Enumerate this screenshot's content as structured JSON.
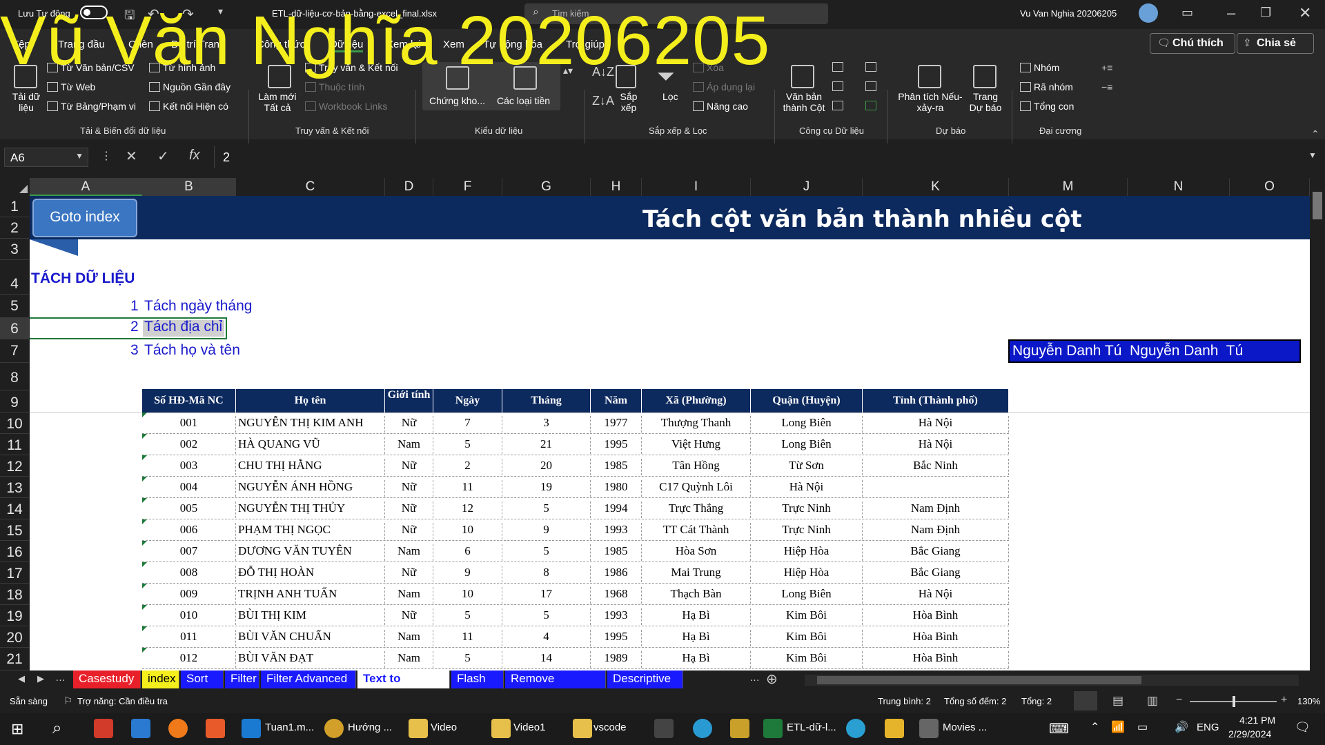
{
  "title_bar": {
    "autosave": "Lưu Tự động",
    "file": "ETL-dữ-liệu-cơ-bản-bằng-excel_final.xlsx",
    "search": "Tìm kiếm",
    "user": "Vu Van Nghia 20206205"
  },
  "watermark": "Vũ Văn Nghĩa 20206205",
  "menu_tabs": [
    "Tệp",
    "Trang đầu",
    "Chèn",
    "Bố trí Trang",
    "Công thức",
    "Dữ liệu",
    "Xem lại",
    "Xem",
    "Tự động hóa",
    "Trợ giúp"
  ],
  "comment_btn": "Chú thích",
  "share_btn": "Chia sẻ",
  "ribbon": {
    "get_data": "Tải dữ liệu",
    "from_text": "Từ Văn bản/CSV",
    "from_web": "Từ Web",
    "from_table": "Từ Bảng/Phạm vi",
    "from_picture": "Từ hình ảnh",
    "recent": "Nguồn Gần đây",
    "existing": "Kết nối Hiện có",
    "group1": "Tải & Biến đổi dữ liệu",
    "refresh": "Làm mới Tất cả",
    "queries": "Truy vấn & Kết nối",
    "properties": "Thuộc tính",
    "links": "Workbook Links",
    "group2": "Truy vấn & Kết nối",
    "stocks": "Chứng kho...",
    "currencies": "Các loại tiền",
    "group3": "Kiểu dữ liệu",
    "sort": "Sắp xếp",
    "filter": "Lọc",
    "clear": "Xóa",
    "reapply": "Áp dụng lại",
    "advanced": "Nâng cao",
    "group4": "Sắp xếp & Lọc",
    "text_to_col": "Văn bản thành Cột",
    "group5": "Công cụ Dữ liệu",
    "whatif": "Phân tích Nếu-xảy-ra",
    "forecast": "Trang Dự báo",
    "group6": "Dự báo",
    "group_btn": "Nhóm",
    "ungroup": "Rã nhóm",
    "subtotal": "Tổng con",
    "group7": "Đại cương"
  },
  "formula_bar": {
    "name_box": "A6",
    "value": "2"
  },
  "columns": [
    "A",
    "B",
    "C",
    "D",
    "F",
    "G",
    "H",
    "I",
    "J",
    "K",
    "M",
    "N",
    "O"
  ],
  "rows": [
    "1",
    "2",
    "3",
    "4",
    "5",
    "6",
    "7",
    "8",
    "9",
    "10",
    "11",
    "12",
    "13",
    "14",
    "15",
    "16",
    "17",
    "18",
    "19",
    "20",
    "21"
  ],
  "sheet": {
    "goto": "Goto index",
    "banner": "Tách cột văn bản thành nhiều cột",
    "heading": "TÁCH DỮ LIỆU",
    "items": [
      {
        "n": "1",
        "t": "Tách ngày tháng"
      },
      {
        "n": "2",
        "t": "Tách địa chỉ"
      },
      {
        "n": "3",
        "t": "Tách họ và tên"
      }
    ],
    "name_box_text": "Nguyễn Danh Tú  Nguyễn Danh  Tú",
    "headers": [
      "Số HĐ-Mã NC",
      "Họ tên",
      "Giới tính",
      "Ngày",
      "Tháng",
      "Năm",
      "Xã (Phường)",
      "Quận (Huyện)",
      "Tỉnh (Thành phố)"
    ],
    "data": [
      [
        "001",
        "NGUYỄN THỊ KIM ANH",
        "Nữ",
        "7",
        "3",
        "1977",
        "Thượng Thanh",
        "Long Biên",
        "Hà Nội"
      ],
      [
        "002",
        "HÀ QUANG VŨ",
        "Nam",
        "5",
        "21",
        "1995",
        "Việt Hưng",
        "Long Biên",
        "Hà Nội"
      ],
      [
        "003",
        "CHU THỊ HẰNG",
        "Nữ",
        "2",
        "20",
        "1985",
        "Tân Hồng",
        "Từ Sơn",
        "Bắc Ninh"
      ],
      [
        "004",
        "NGUYỄN ÁNH HỒNG",
        "Nữ",
        "11",
        "19",
        "1980",
        "C17 Quỳnh Lôi",
        "Hà Nội",
        ""
      ],
      [
        "005",
        "NGUYỄN THỊ THỦY",
        "Nữ",
        "12",
        "5",
        "1994",
        "Trực Thắng",
        "Trực Ninh",
        "Nam Định"
      ],
      [
        "006",
        "PHẠM THỊ NGỌC",
        "Nữ",
        "10",
        "9",
        "1993",
        "TT Cát Thành",
        "Trực Ninh",
        "Nam Định"
      ],
      [
        "007",
        "DƯƠNG VĂN TUYÊN",
        "Nam",
        "6",
        "5",
        "1985",
        "Hòa Sơn",
        "Hiệp Hòa",
        "Bắc Giang"
      ],
      [
        "008",
        "ĐỖ THỊ HOÀN",
        "Nữ",
        "9",
        "8",
        "1986",
        "Mai Trung",
        "Hiệp Hòa",
        "Bắc Giang"
      ],
      [
        "009",
        "TRỊNH ANH TUẤN",
        "Nam",
        "10",
        "17",
        "1968",
        "Thạch Bàn",
        "Long Biên",
        "Hà Nội"
      ],
      [
        "010",
        "BÙI THỊ KIM",
        "Nữ",
        "5",
        "5",
        "1993",
        "Hạ Bì",
        "Kim Bôi",
        "Hòa Bình"
      ],
      [
        "011",
        "BÙI VĂN CHUẨN",
        "Nam",
        "11",
        "4",
        "1995",
        "Hạ Bì",
        "Kim Bôi",
        "Hòa Bình"
      ],
      [
        "012",
        "BÙI VĂN ĐẠT",
        "Nam",
        "5",
        "14",
        "1989",
        "Hạ Bì",
        "Kim Bôi",
        "Hòa Bình"
      ]
    ]
  },
  "sheet_tabs": [
    {
      "label": "Casestudy",
      "bg": "#e8202a"
    },
    {
      "label": "index",
      "bg": "#f4ef1c",
      "fg": "#000"
    },
    {
      "label": "Sort",
      "bg": "#1a1aff"
    },
    {
      "label": "Filter",
      "bg": "#1a1aff"
    },
    {
      "label": "Filter Advanced",
      "bg": "#1a1aff"
    },
    {
      "label": "Text to columns",
      "bg": "#ffffff",
      "fg": "#1a1aff"
    },
    {
      "label": "Flash fill",
      "bg": "#1a1aff"
    },
    {
      "label": "Remove Duplicates",
      "bg": "#1a1aff"
    },
    {
      "label": "Descriptive s",
      "bg": "#1a1aff"
    }
  ],
  "status_bar": {
    "ready": "Sẵn sàng",
    "access": "Trợ năng: Cần điều tra",
    "avg": "Trung bình: 2",
    "count": "Tổng số đếm: 2",
    "sum": "Tổng: 2",
    "zoom": "130%"
  },
  "taskbar": {
    "apps": [
      "Tuan1.m...",
      "Hướng ...",
      "Video",
      "Video1",
      "vscode",
      "ETL-dữ-l...",
      "Movies ..."
    ],
    "lang": "ENG",
    "time": "4:21 PM",
    "date": "2/29/2024"
  }
}
